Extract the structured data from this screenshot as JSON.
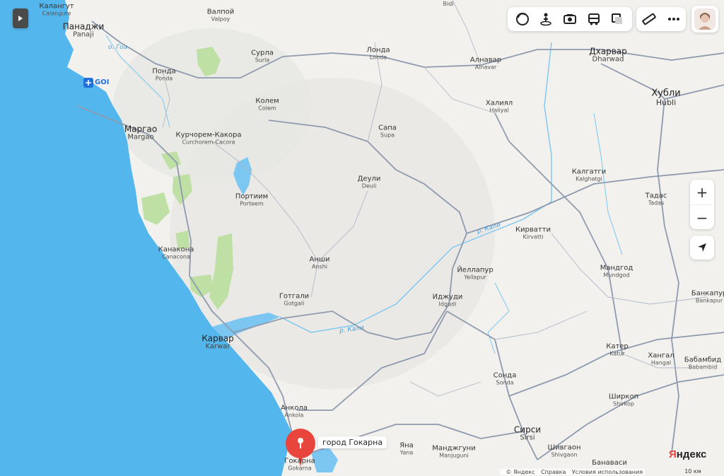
{
  "controls": {
    "zoom_in": "+",
    "zoom_out": "−",
    "panel_toggle_icon": "play-icon",
    "toolbar_icons": [
      "layers-icon",
      "route-person-icon",
      "panorama-camera-icon",
      "bus-icon",
      "map-type-icon"
    ],
    "ruler_icon": "ruler-icon",
    "more_icon": "more-dots-icon"
  },
  "place_marker": {
    "label": "город Гокарна",
    "color": "#e8453c"
  },
  "places": [
    {
      "ru": "Калангут",
      "en": "Calangute"
    },
    {
      "ru": "Панаджи",
      "en": "Panaji"
    },
    {
      "ru": "о. Гоа",
      "en": ""
    },
    {
      "ru": "Понда",
      "en": "Ponda"
    },
    {
      "ru": "Валпой",
      "en": "Valpoy"
    },
    {
      "ru": "Сурла",
      "en": "Surla"
    },
    {
      "ru": "Колем",
      "en": "Colem"
    },
    {
      "ru": "Маргао",
      "en": "Margao"
    },
    {
      "ru": "Курчорем-Какора",
      "en": "Curchorem-Cacora"
    },
    {
      "ru": "Портиим",
      "en": "Porteem"
    },
    {
      "ru": "Канакона",
      "en": "Canacona"
    },
    {
      "ru": "Готгали",
      "en": "Gotgali"
    },
    {
      "ru": "Анши",
      "en": "Anshi"
    },
    {
      "ru": "Карвар",
      "en": "Karwar"
    },
    {
      "ru": "Анкола",
      "en": "Ankola"
    },
    {
      "ru": "Гокарна",
      "en": "Gokarna"
    },
    {
      "ru": "Яна",
      "en": "Yana"
    },
    {
      "ru": "Манджгуни",
      "en": "Manjuguni"
    },
    {
      "ru": "Сирси",
      "en": "Sirsi"
    },
    {
      "ru": "Шивгаон",
      "en": "Shivgaon"
    },
    {
      "ru": "Банаваси",
      "en": ""
    },
    {
      "ru": "Сонда",
      "en": "Sonda"
    },
    {
      "ru": "Иджуди",
      "en": "Idgudi"
    },
    {
      "ru": "Йеллапур",
      "en": "Yellapur"
    },
    {
      "ru": "Кирватти",
      "en": "Kirvatti"
    },
    {
      "ru": "Деули",
      "en": "Deuli"
    },
    {
      "ru": "Сапа",
      "en": "Supa"
    },
    {
      "ru": "Лонда",
      "en": "Londa"
    },
    {
      "ru": "Алнавар",
      "en": "Alnavar"
    },
    {
      "ru": "Халиял",
      "en": "Haliyal"
    },
    {
      "ru": "Дхарвар",
      "en": "Dharwad"
    },
    {
      "ru": "Хубли",
      "en": "Hubli"
    },
    {
      "ru": "Калгатги",
      "en": "Kalghatgi"
    },
    {
      "ru": "Тадас",
      "en": "Tadas"
    },
    {
      "ru": "Мандгод",
      "en": "Mundgod"
    },
    {
      "ru": "Банкапур",
      "en": "Bankapur"
    },
    {
      "ru": "Катер",
      "en": "Katur"
    },
    {
      "ru": "Хангал",
      "en": "Hangal"
    },
    {
      "ru": "Бабамбид",
      "en": "Babambid"
    },
    {
      "ru": "Ширкоп",
      "en": "Shirkop"
    },
    {
      "ru": "Биди",
      "en": "Bidi"
    }
  ],
  "rivers": [
    "р. Кали",
    "р. Кали"
  ],
  "airport": {
    "code": "GOI"
  },
  "footer": {
    "copyright": "© Яндекс",
    "help": "Справка",
    "terms": "Условия использования"
  },
  "brand": "Яндекс",
  "scale": "10 км",
  "colors": {
    "sea": "#53b6ec",
    "land": "#f2f1ee",
    "forest": "#bfe0a5",
    "road": "#8e9aae",
    "river": "#7cc7f2"
  }
}
